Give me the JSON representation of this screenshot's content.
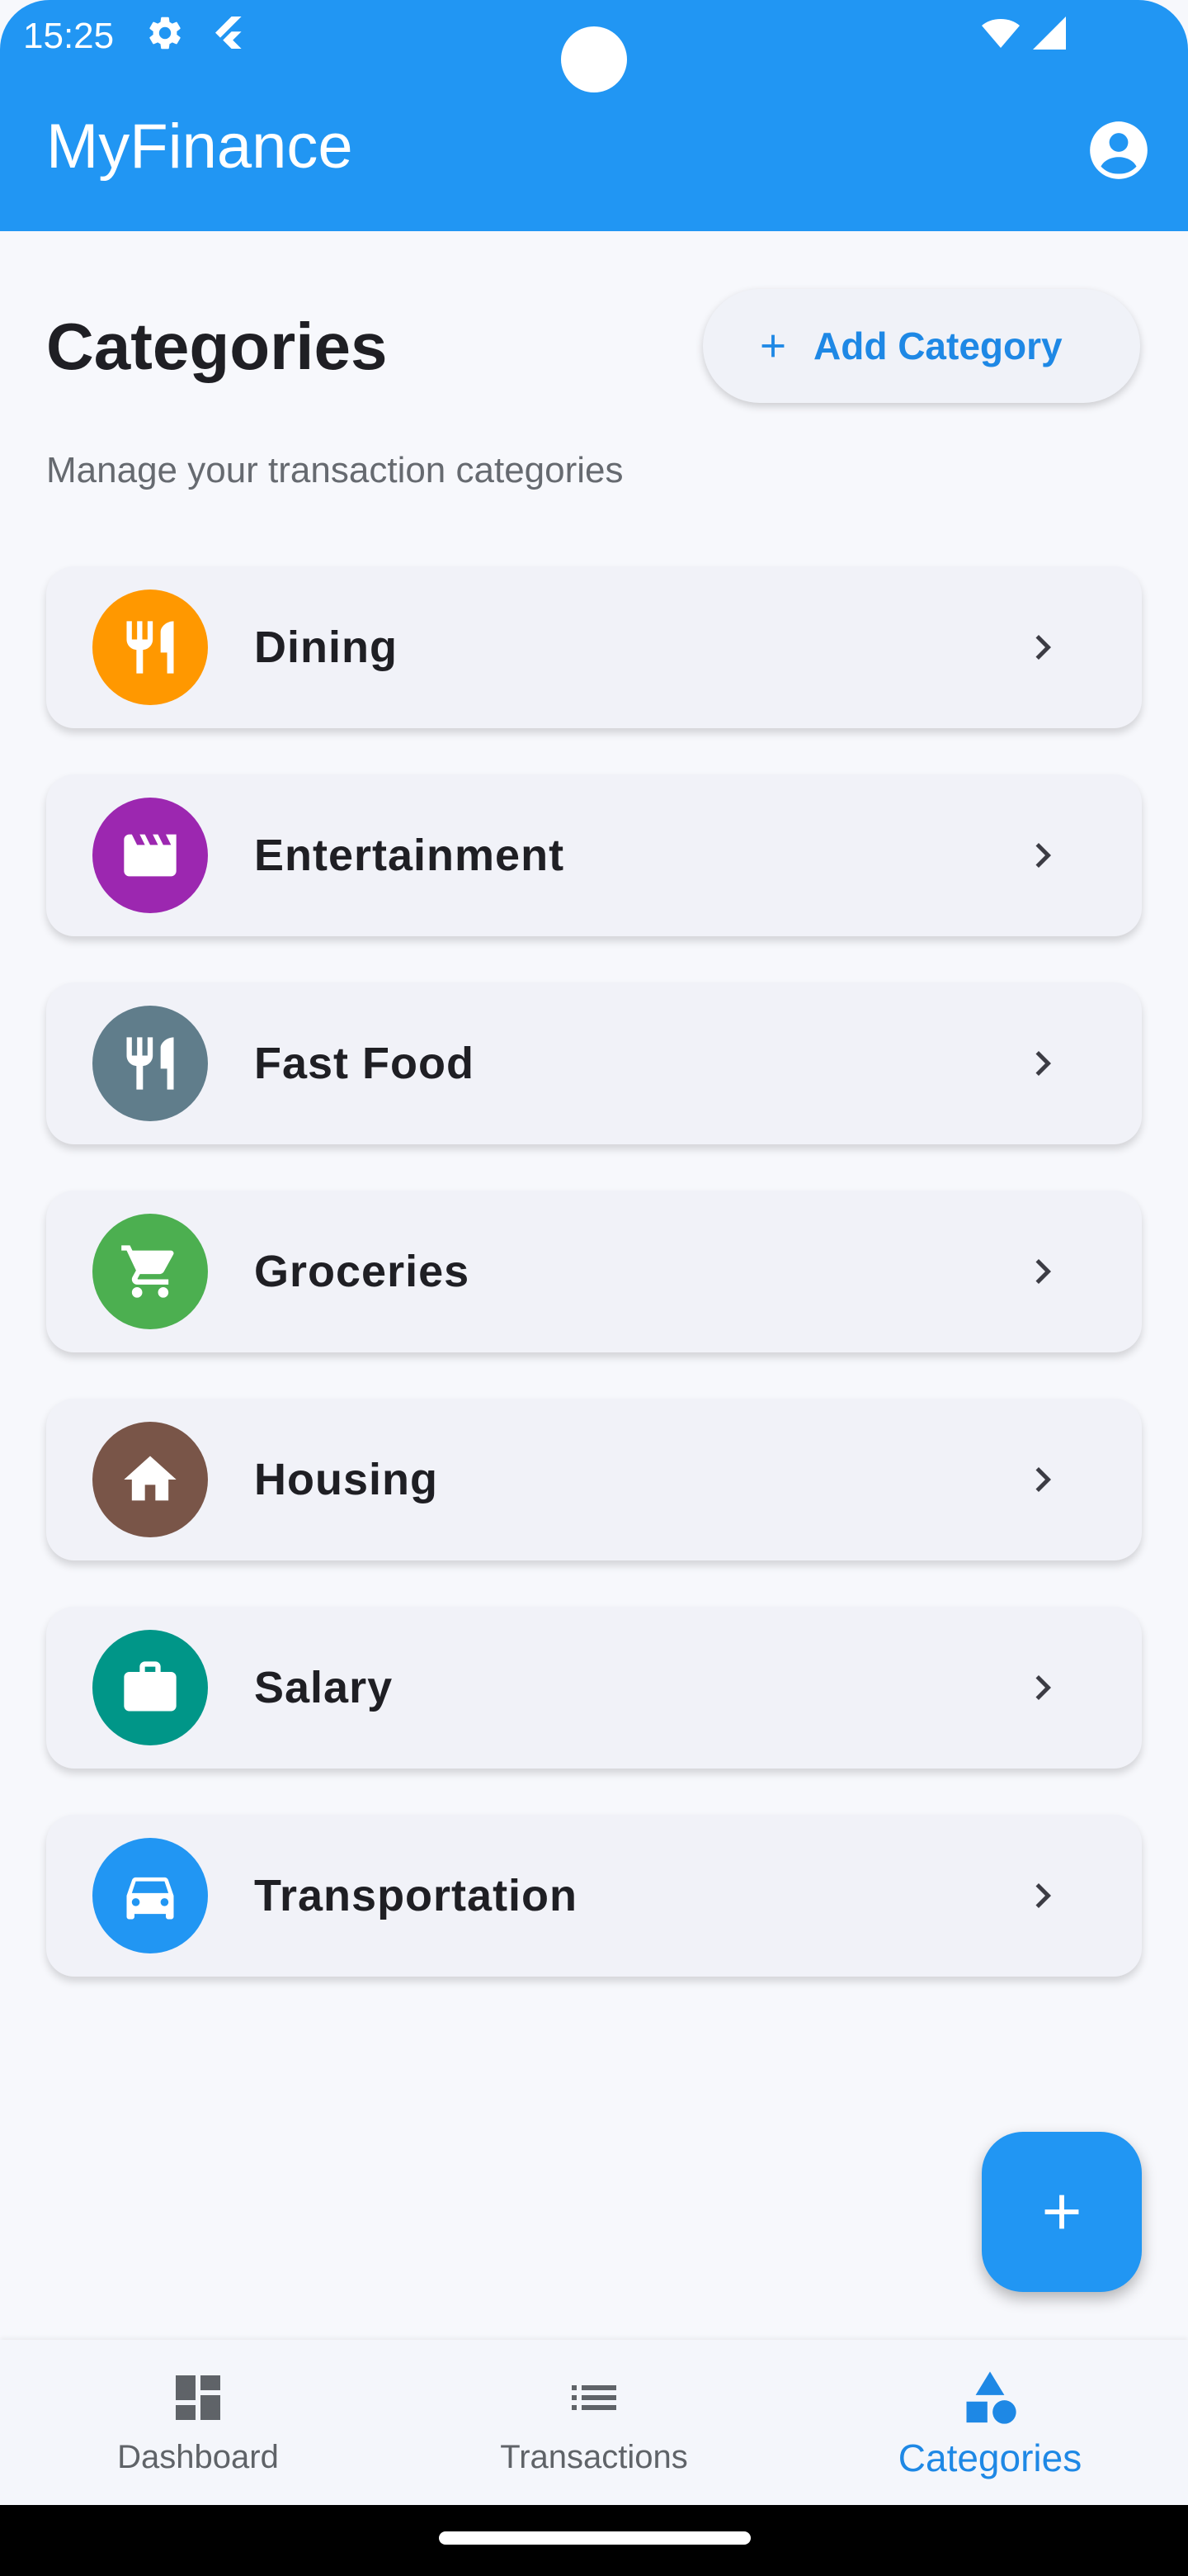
{
  "status_bar": {
    "time": "15:25",
    "icons": [
      "settings-icon",
      "flutter-icon",
      "wifi-icon",
      "signal-icon"
    ]
  },
  "app_bar": {
    "title": "MyFinance",
    "action_icon": "account-circle-icon"
  },
  "header": {
    "title": "Categories",
    "subtitle": "Manage your transaction categories",
    "add_button_label": "Add Category"
  },
  "categories": [
    {
      "label": "Dining",
      "icon": "restaurant-icon",
      "color": "#ff9800"
    },
    {
      "label": "Entertainment",
      "icon": "movie-icon",
      "color": "#9c27b0"
    },
    {
      "label": "Fast Food",
      "icon": "restaurant-icon",
      "color": "#607d8b"
    },
    {
      "label": "Groceries",
      "icon": "shopping-cart-icon",
      "color": "#4caf50"
    },
    {
      "label": "Housing",
      "icon": "home-icon",
      "color": "#795548"
    },
    {
      "label": "Salary",
      "icon": "work-icon",
      "color": "#009688"
    },
    {
      "label": "Transportation",
      "icon": "car-icon",
      "color": "#2196f3"
    }
  ],
  "fab": {
    "icon": "add-icon"
  },
  "bottom_nav": {
    "items": [
      {
        "label": "Dashboard",
        "icon": "dashboard-icon",
        "active": false
      },
      {
        "label": "Transactions",
        "icon": "list-icon",
        "active": false
      },
      {
        "label": "Categories",
        "icon": "category-icon",
        "active": true
      }
    ]
  },
  "colors": {
    "primary": "#2196f3",
    "accent_text": "#1e88e5",
    "background": "#f7f8fc",
    "card": "#f1f2f8"
  }
}
